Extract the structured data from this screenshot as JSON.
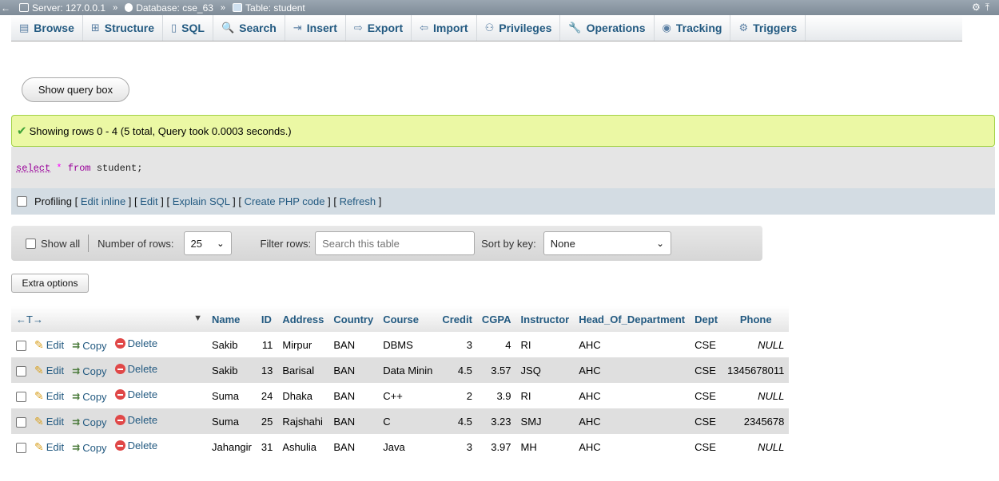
{
  "breadcrumb": {
    "server_label": "Server: 127.0.0.1",
    "database_label": "Database: cse_63",
    "table_label": "Table: student",
    "separator": "»"
  },
  "tabs": [
    {
      "label": "Browse",
      "icon": "browse-icon",
      "glyph": "▤"
    },
    {
      "label": "Structure",
      "icon": "structure-icon",
      "glyph": "⊞"
    },
    {
      "label": "SQL",
      "icon": "sql-icon",
      "glyph": "▯"
    },
    {
      "label": "Search",
      "icon": "search-icon",
      "glyph": "🔍"
    },
    {
      "label": "Insert",
      "icon": "insert-icon",
      "glyph": "⇥"
    },
    {
      "label": "Export",
      "icon": "export-icon",
      "glyph": "⇨"
    },
    {
      "label": "Import",
      "icon": "import-icon",
      "glyph": "⇦"
    },
    {
      "label": "Privileges",
      "icon": "privileges-icon",
      "glyph": "⚇"
    },
    {
      "label": "Operations",
      "icon": "operations-icon",
      "glyph": "🔧"
    },
    {
      "label": "Tracking",
      "icon": "tracking-icon",
      "glyph": "◉"
    },
    {
      "label": "Triggers",
      "icon": "triggers-icon",
      "glyph": "⚙"
    }
  ],
  "query_box_button": "Show query box",
  "message": "Showing rows 0 - 4 (5 total, Query took 0.0003 seconds.)",
  "sql": {
    "select": "select",
    "star": "*",
    "from": "from",
    "rest": "student;"
  },
  "profiling": {
    "label": "Profiling",
    "edit_inline": "Edit inline",
    "edit": "Edit",
    "explain": "Explain SQL",
    "php": "Create PHP code",
    "refresh": "Refresh"
  },
  "navigation": {
    "show_all": "Show all",
    "rows_label": "Number of rows:",
    "rows_value": "25",
    "filter_label": "Filter rows:",
    "filter_placeholder": "Search this table",
    "sort_label": "Sort by key:",
    "sort_value": "None"
  },
  "extra_options": "Extra options",
  "table": {
    "arrows": "←T→",
    "sort_indicator": "▼",
    "columns": [
      "Name",
      "ID",
      "Address",
      "Country",
      "Course",
      "Credit",
      "CGPA",
      "Instructor",
      "Head_Of_Department",
      "Dept",
      "Phone"
    ],
    "actions": {
      "edit": "Edit",
      "copy": "Copy",
      "delete": "Delete"
    },
    "rows": [
      [
        "Sakib",
        "11",
        "Mirpur",
        "BAN",
        "DBMS",
        "3",
        "4",
        "RI",
        "AHC",
        "CSE",
        "NULL"
      ],
      [
        "Sakib",
        "13",
        "Barisal",
        "BAN",
        "Data Minin",
        "4.5",
        "3.57",
        "JSQ",
        "AHC",
        "CSE",
        "1345678011"
      ],
      [
        "Suma",
        "24",
        "Dhaka",
        "BAN",
        "C++",
        "2",
        "3.9",
        "RI",
        "AHC",
        "CSE",
        "NULL"
      ],
      [
        "Suma",
        "25",
        "Rajshahi",
        "BAN",
        "C",
        "4.5",
        "3.23",
        "SMJ",
        "AHC",
        "CSE",
        "2345678"
      ],
      [
        "Jahangir",
        "31",
        "Ashulia",
        "BAN",
        "Java",
        "3",
        "3.97",
        "MH",
        "AHC",
        "CSE",
        "NULL"
      ]
    ]
  },
  "colors": {
    "link": "#235a81",
    "success_bg": "#ebf8a4",
    "row_even": "#dfdfdf"
  }
}
